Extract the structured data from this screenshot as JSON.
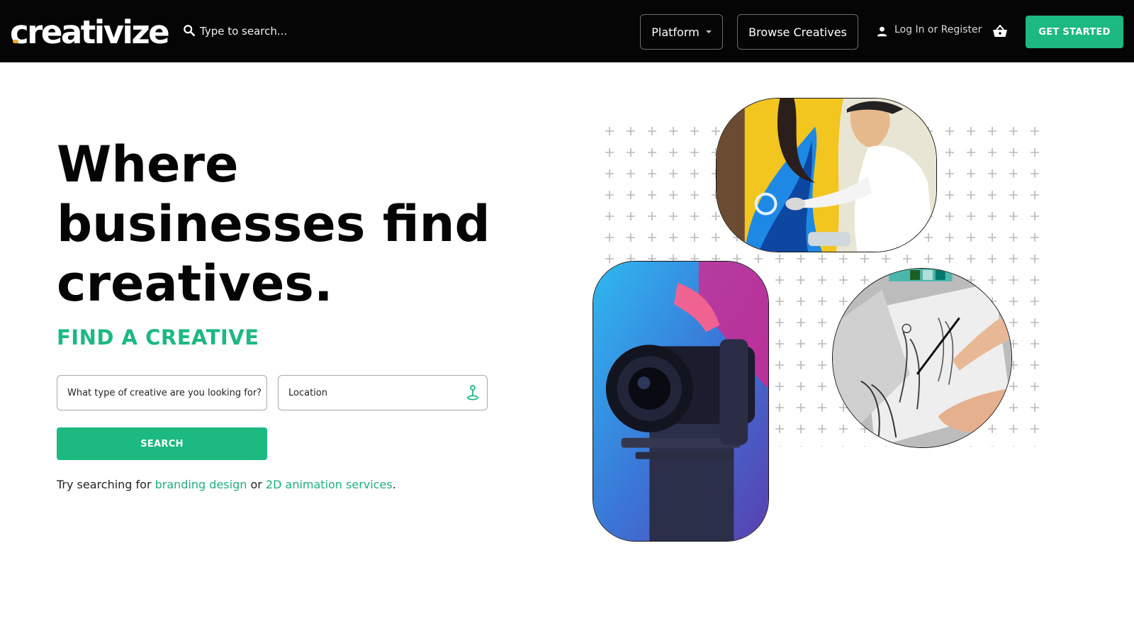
{
  "header": {
    "logo": "creativize",
    "search_placeholder": "Type to search...",
    "platform_label": "Platform",
    "browse_label": "Browse Creatives",
    "login_label": "Log In or Register",
    "cta_label": "GET STARTED"
  },
  "hero": {
    "title_line1": "Where",
    "title_line2": "businesses find",
    "title_line3": "creatives.",
    "subtitle": "FIND A CREATIVE",
    "type_placeholder": "What type of creative are you looking for?",
    "location_placeholder": "Location",
    "search_label": "SEARCH",
    "try_prefix": "Try searching for ",
    "try_link1": "branding design",
    "try_mid": " or ",
    "try_link2": "2D animation services",
    "try_suffix": "."
  },
  "colors": {
    "brand_green": "#1cb981",
    "header_bg": "#050505"
  },
  "icons": [
    "search-icon",
    "caret-down-icon",
    "user-icon",
    "basket-icon",
    "map-pin-icon"
  ]
}
